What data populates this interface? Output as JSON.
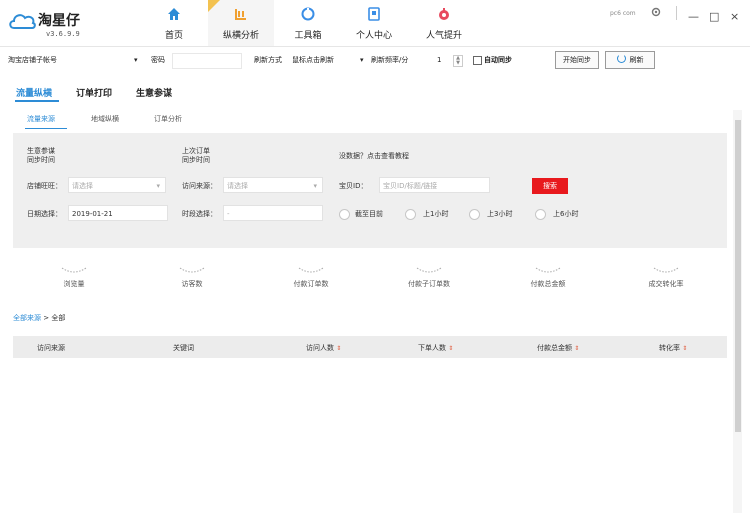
{
  "app": {
    "name": "淘星仔",
    "version": "v3.6.9.9"
  },
  "nav": [
    {
      "label": "首页",
      "icon": "home-icon"
    },
    {
      "label": "纵横分析",
      "icon": "analysis-icon",
      "active": true
    },
    {
      "label": "工具箱",
      "icon": "toolbox-icon"
    },
    {
      "label": "个人中心",
      "icon": "user-center-icon"
    },
    {
      "label": "人气提升",
      "icon": "popularity-icon"
    }
  ],
  "window": {
    "watermark": "pc6 com",
    "settings_icon": "gear-icon",
    "minimize": "—",
    "maximize": "□",
    "close": "×"
  },
  "toolbar": {
    "account_placeholder": "淘宝店铺子帐号",
    "password_label": "密码",
    "refresh_mode_label": "刷新方式",
    "refresh_mode_value": "鼠标点击刷新",
    "refresh_freq_label": "刷新频率/分",
    "refresh_freq_value": "1",
    "auto_sync_label": "自动同步",
    "start_sync": "开始同步",
    "refresh": "刷新"
  },
  "main_tabs": [
    "流量纵横",
    "订单打印",
    "生意参谋"
  ],
  "sub_tabs": [
    "流量来源",
    "地域纵横",
    "订单分析"
  ],
  "filters": {
    "sync_biz_line1": "生意参谋",
    "sync_biz_line2": "同步时间",
    "sync_order_line1": "上次订单",
    "sync_order_line2": "同步时间",
    "no_data_hint": "没数据？点击查看教程",
    "shop_label": "店铺旺旺：",
    "shop_placeholder": "请选择",
    "source_label": "访问来源：",
    "source_placeholder": "请选择",
    "item_label": "宝贝ID：",
    "item_placeholder": "宝贝ID/标题/链接",
    "search_btn": "搜索",
    "date_label": "日期选择：",
    "date_value": "2019-01-21",
    "period_label": "时段选择：",
    "period_value": "-",
    "radio_options": [
      "截至目前",
      "上1小时",
      "上3小时",
      "上6小时"
    ]
  },
  "stats": [
    "浏览量",
    "访客数",
    "付款订单数",
    "付款子订单数",
    "付款总金额",
    "成交转化率"
  ],
  "breadcrumb": {
    "link": "全部来源",
    "separator": " > ",
    "current": "全部"
  },
  "table_headers": [
    {
      "label": "访问来源",
      "sortable": false
    },
    {
      "label": "关键词",
      "sortable": false
    },
    {
      "label": "访问人数",
      "sortable": true
    },
    {
      "label": "下单人数",
      "sortable": true
    },
    {
      "label": "付款总金额",
      "sortable": true
    },
    {
      "label": "转化率",
      "sortable": true
    }
  ],
  "colors": {
    "accent": "#2d8cd6",
    "search_btn": "#e8191d",
    "nav_icon_blue": "#3a8ee6",
    "nav_icon_orange": "#f0a030",
    "nav_icon_red": "#e84a5f"
  }
}
